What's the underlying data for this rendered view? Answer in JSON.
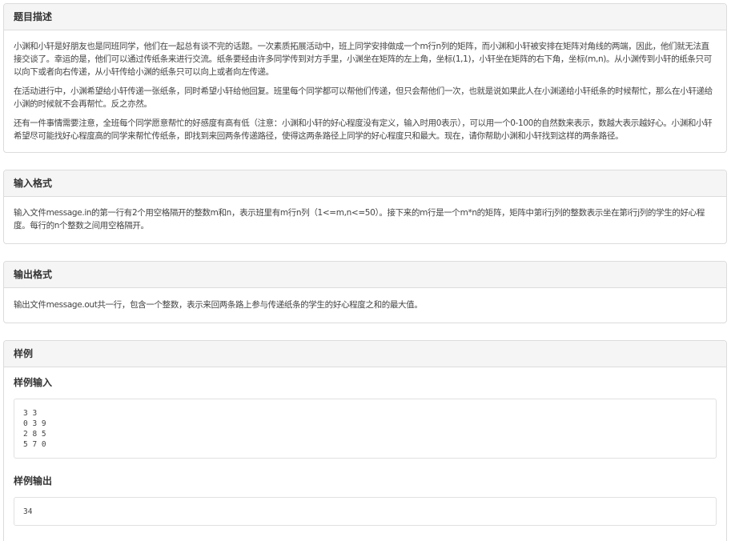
{
  "sections": {
    "description": {
      "title": "题目描述",
      "paragraphs": [
        "小渊和小轩是好朋友也是同班同学，他们在一起总有谈不完的话题。一次素质拓展活动中，班上同学安排做成一个m行n列的矩阵，而小渊和小轩被安排在矩阵对角线的两端，因此，他们就无法直接交谈了。幸运的是，他们可以通过传纸条来进行交流。纸条要经由许多同学传到对方手里，小渊坐在矩阵的左上角，坐标(1,1)，小轩坐在矩阵的右下角，坐标(m,n)。从小渊传到小轩的纸条只可以向下或者向右传递，从小轩传给小渊的纸条只可以向上或者向左传递。",
        "在活动进行中，小渊希望给小轩传递一张纸条，同时希望小轩给他回复。班里每个同学都可以帮他们传递，但只会帮他们一次，也就是说如果此人在小渊递给小轩纸条的时候帮忙，那么在小轩递给小渊的时候就不会再帮忙。反之亦然。",
        "还有一件事情需要注意，全班每个同学愿意帮忙的好感度有高有低（注意：小渊和小轩的好心程度没有定义，输入时用0表示），可以用一个0-100的自然数来表示，数越大表示越好心。小渊和小轩希望尽可能找好心程度高的同学来帮忙传纸条，即找到来回两条传递路径，使得这两条路径上同学的好心程度只和最大。现在，请你帮助小渊和小轩找到这样的两条路径。"
      ]
    },
    "input_format": {
      "title": "输入格式",
      "text": "输入文件message.in的第一行有2个用空格隔开的整数m和n，表示班里有m行n列（1<=m,n<=50）。接下来的m行是一个m*n的矩阵，矩阵中第i行j列的整数表示坐在第i行j列的学生的好心程度。每行的n个整数之间用空格隔开。"
    },
    "output_format": {
      "title": "输出格式",
      "text": "输出文件message.out共一行，包含一个整数，表示来回两条路上参与传递纸条的学生的好心程度之和的最大值。"
    },
    "samples": {
      "title": "样例",
      "input_title": "样例输入",
      "input_text": "3 3\n0 3 9\n2 8 5\n5 7 0",
      "output_title": "样例输出",
      "output_text": "34"
    }
  }
}
